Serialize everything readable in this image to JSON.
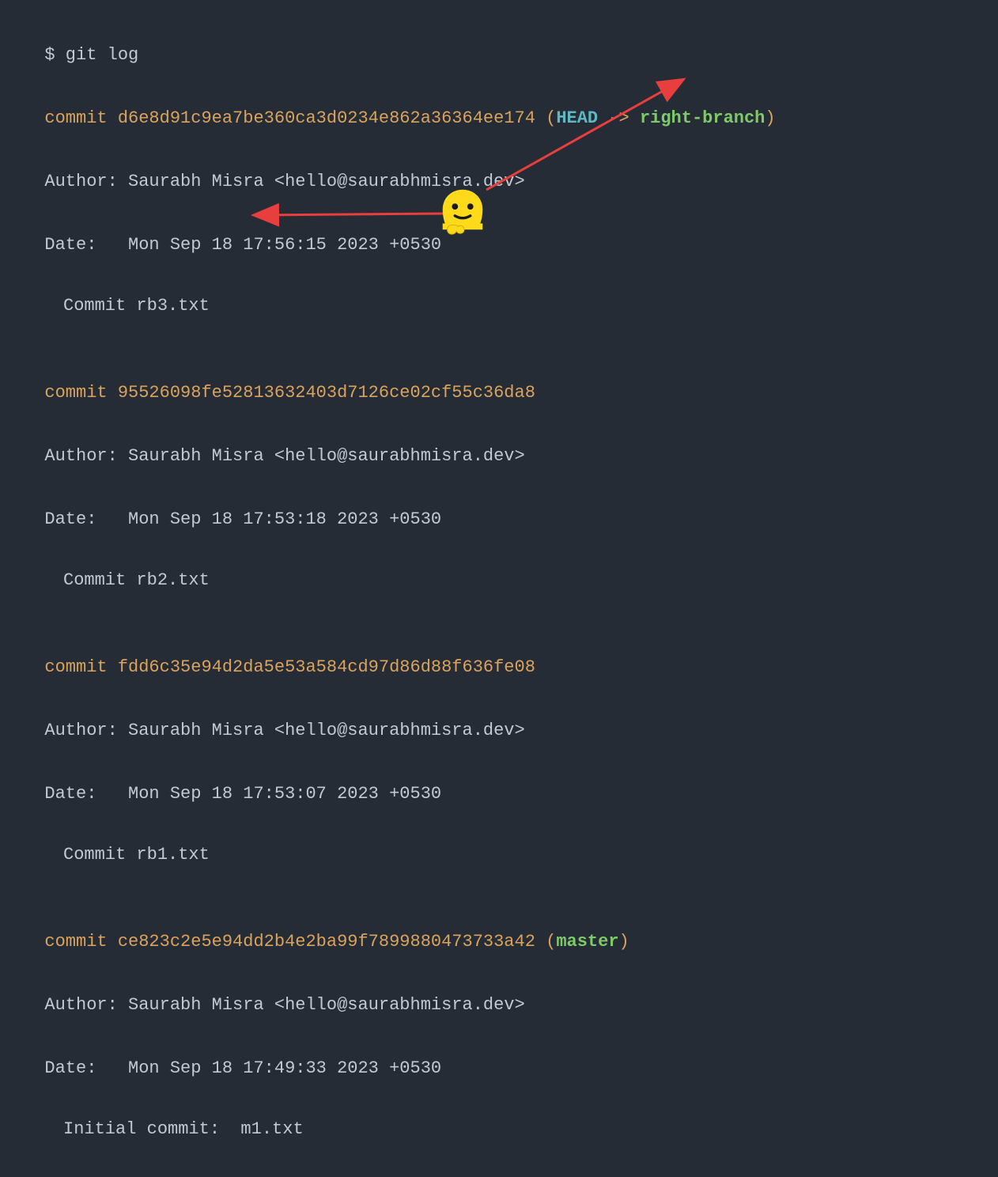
{
  "prompt": "$ git log",
  "commits": [
    {
      "commit_prefix": "commit ",
      "hash": "d6e8d91c9ea7be360ca3d0234e862a36364ee174",
      "ref_open": " (",
      "head": "HEAD",
      "arrow": " -> ",
      "branch": "right-branch",
      "ref_close": ")",
      "author_label": "Author: ",
      "author": "Saurabh Misra <hello@saurabhmisra.dev>",
      "date_label": "Date:   ",
      "date": "Mon Sep 18 17:56:15 2023 +0530",
      "message": "Commit rb3.txt"
    },
    {
      "commit_prefix": "commit ",
      "hash": "95526098fe52813632403d7126ce02cf55c36da8",
      "author_label": "Author: ",
      "author": "Saurabh Misra <hello@saurabhmisra.dev>",
      "date_label": "Date:   ",
      "date": "Mon Sep 18 17:53:18 2023 +0530",
      "message": "Commit rb2.txt"
    },
    {
      "commit_prefix": "commit ",
      "hash": "fdd6c35e94d2da5e53a584cd97d86d88f636fe08",
      "author_label": "Author: ",
      "author": "Saurabh Misra <hello@saurabhmisra.dev>",
      "date_label": "Date:   ",
      "date": "Mon Sep 18 17:53:07 2023 +0530",
      "message": "Commit rb1.txt"
    },
    {
      "commit_prefix": "commit ",
      "hash": "ce823c2e5e94dd2b4e2ba99f7899880473733a42",
      "ref_open": " (",
      "branch": "master",
      "ref_close": ")",
      "author_label": "Author: ",
      "author": "Saurabh Misra <hello@saurabhmisra.dev>",
      "date_label": "Date:   ",
      "date": "Mon Sep 18 17:49:33 2023 +0530",
      "message": "Initial commit:  m1.txt"
    }
  ]
}
